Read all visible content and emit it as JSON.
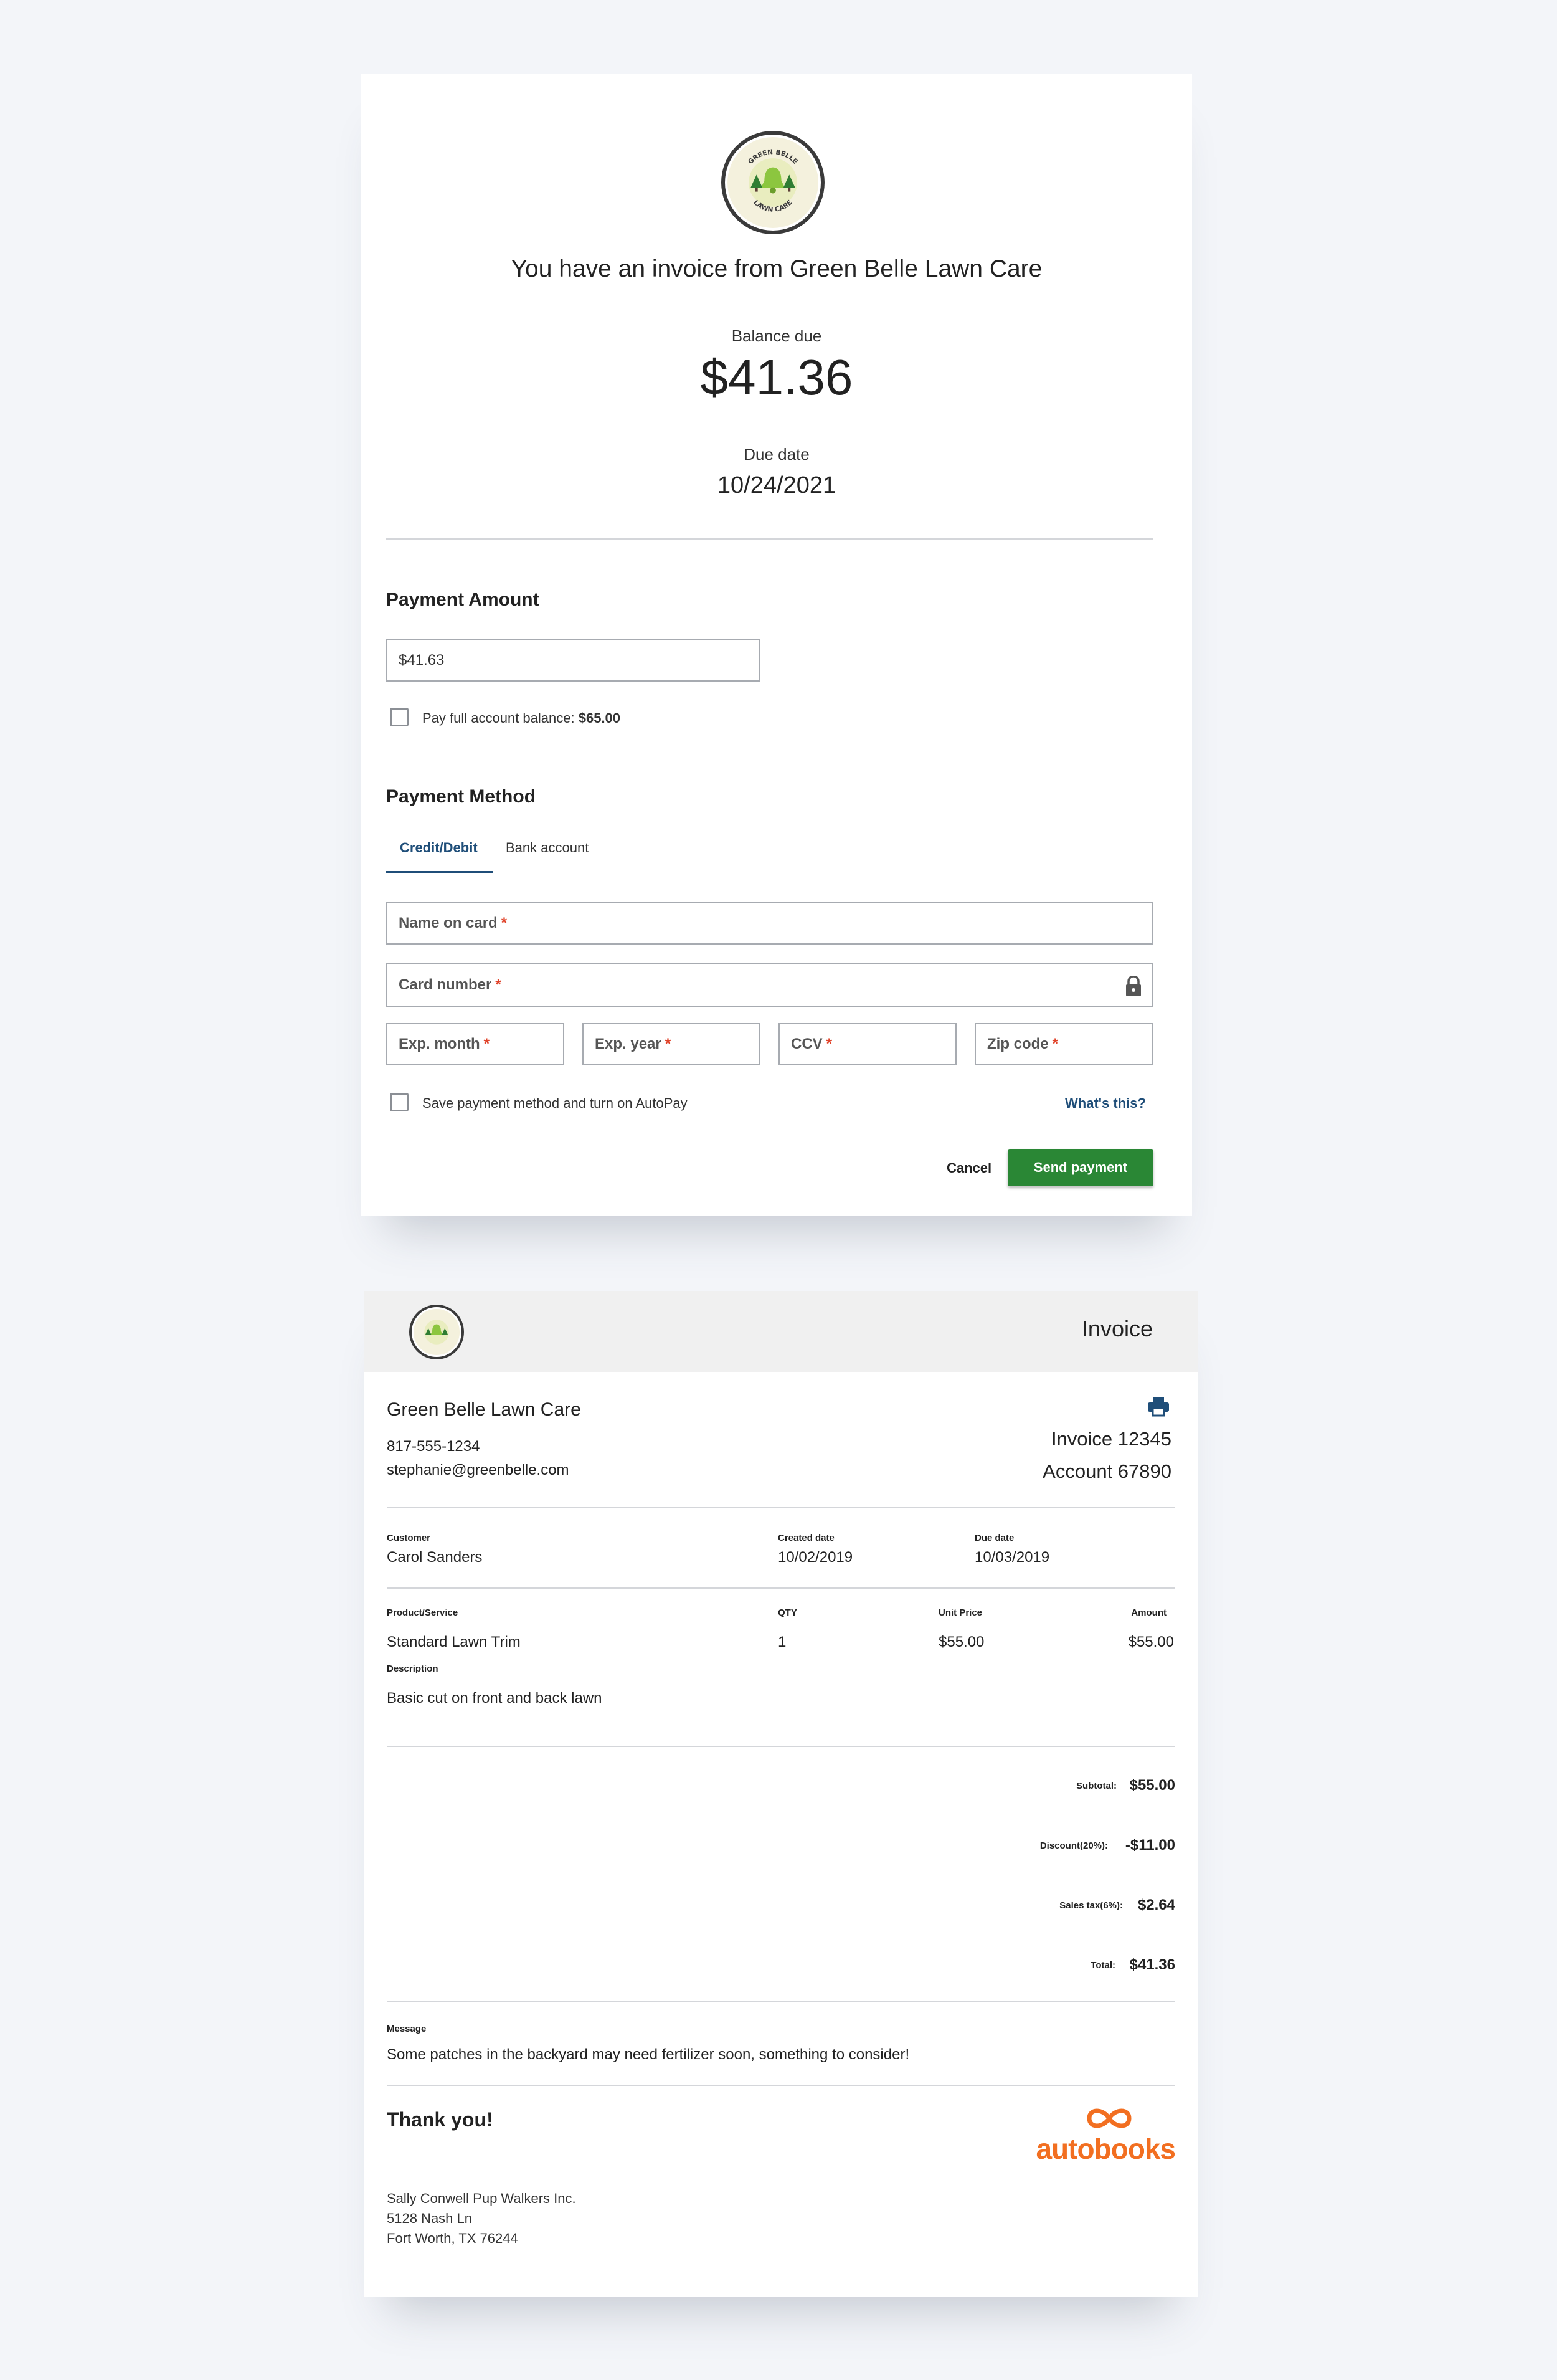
{
  "payment": {
    "logo": {
      "top_text": "GREEN BELLE",
      "bottom_text": "LAWN CARE"
    },
    "heading": "You have an invoice from Green Belle Lawn Care",
    "balance_label": "Balance due",
    "balance_value": "$41.36",
    "due_label": "Due date",
    "due_value": "10/24/2021",
    "amount_section_title": "Payment Amount",
    "amount_input_value": "$41.63",
    "full_balance_label": "Pay full account balance:",
    "full_balance_value": "$65.00",
    "method_section_title": "Payment Method",
    "tabs": [
      {
        "label": "Credit/Debit",
        "active": true
      },
      {
        "label": "Bank account",
        "active": false
      }
    ],
    "fields": {
      "name_on_card": "Name on card",
      "card_number": "Card number",
      "exp_month": "Exp. month",
      "exp_year": "Exp. year",
      "ccv": "CCV",
      "zip": "Zip code",
      "required_mark": "*"
    },
    "autopay_label": "Save payment method and turn on AutoPay",
    "whats_this": "What's this?",
    "cancel_label": "Cancel",
    "send_label": "Send payment",
    "icons": {
      "lock": "lock-icon"
    }
  },
  "invoice": {
    "title": "Invoice",
    "company_name": "Green Belle Lawn Care",
    "phone": "817-555-1234",
    "email": "stephanie@greenbelle.com",
    "invoice_number": "Invoice 12345",
    "account_number": "Account 67890",
    "customer_label": "Customer",
    "customer_value": "Carol Sanders",
    "created_label": "Created date",
    "created_value": "10/02/2019",
    "due_label": "Due date",
    "due_value": "10/03/2019",
    "table_headers": {
      "product": "Product/Service",
      "qty": "QTY",
      "unit": "Unit Price",
      "amount": "Amount"
    },
    "line_items": [
      {
        "product": "Standard Lawn Trim",
        "qty": "1",
        "unit": "$55.00",
        "amount": "$55.00"
      }
    ],
    "description_label": "Description",
    "description_value": "Basic cut on front and back lawn",
    "totals": {
      "subtotal_label": "Subtotal:",
      "subtotal_value": "$55.00",
      "discount_label": "Discount(20%):",
      "discount_value": "-$11.00",
      "tax_label": "Sales tax(6%):",
      "tax_value": "$2.64",
      "total_label": "Total:",
      "total_value": "$41.36"
    },
    "message_label": "Message",
    "message_value": "Some patches in the backyard may need fertilizer soon, something to consider!",
    "thank_you": "Thank you!",
    "brand": "autobooks",
    "address": [
      "Sally Conwell Pup Walkers Inc.",
      "5128 Nash Ln",
      "Fort Worth, TX 76244"
    ],
    "icons": {
      "print": "print-icon"
    }
  },
  "colors": {
    "accent_green": "#2a8735",
    "link_blue": "#1f4e79",
    "brand_orange": "#f26f21",
    "required_red": "#e0432a"
  }
}
